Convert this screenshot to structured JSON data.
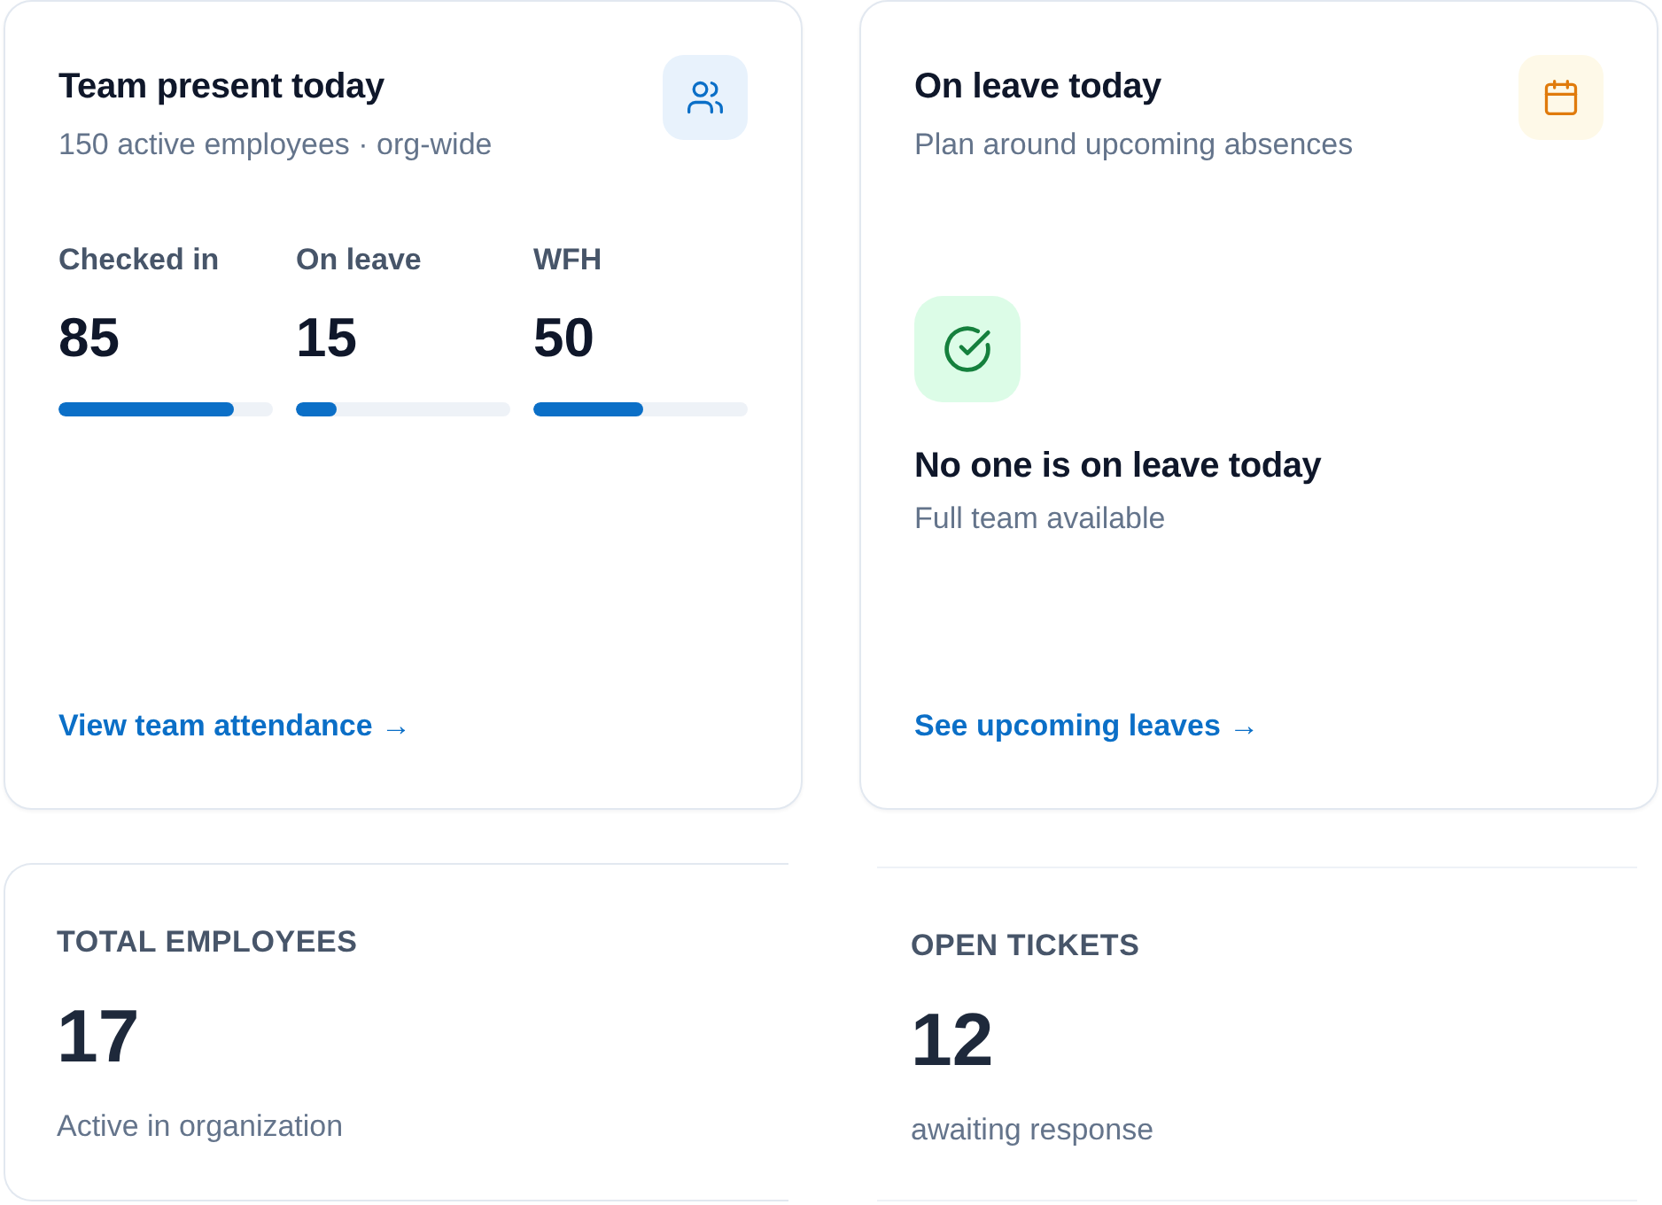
{
  "cards": [
    {
      "kind": "attendance",
      "title": "Team present today",
      "subtitle": "150 active employees · org-wide",
      "stats": [
        {
          "label": "Checked in",
          "value": "85",
          "level": 0.82
        },
        {
          "label": "On leave",
          "value": "15",
          "level": 0.19
        },
        {
          "label": "WFH",
          "value": "50",
          "level": 0.51
        }
      ],
      "link": "View team attendance →"
    },
    {
      "kind": "leave",
      "title": "On leave today",
      "subtitle": "Plan around upcoming absences",
      "empty_state": {
        "title": "No one is on leave today",
        "subtitle": "Full team available"
      },
      "link": "See upcoming leaves →"
    }
  ],
  "metrics": [
    {
      "label": "TOTAL EMPLOYEES",
      "value": "17",
      "caption": "Active in organization"
    },
    {
      "label": "OPEN TICKETS",
      "value": "12",
      "caption": "awaiting response"
    }
  ]
}
